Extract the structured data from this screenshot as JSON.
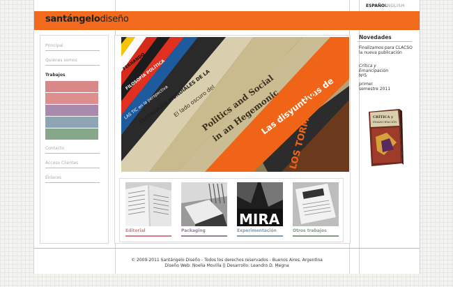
{
  "brand": {
    "name_bold": "santángelo",
    "name_light": "diseño",
    "accent": "#f26a1b"
  },
  "lang": {
    "es": "ESPAÑOL",
    "en": "ENGLISH"
  },
  "nav": {
    "items": [
      {
        "label": "Principal"
      },
      {
        "label": "Quiénes somos"
      },
      {
        "label": "Trabajos"
      },
      {
        "label": "Contacto"
      },
      {
        "label": "Acceso Clientes"
      },
      {
        "label": "Enlaces"
      }
    ],
    "swatches": [
      "#d98787",
      "#dc8f8e",
      "#a98aac",
      "#8ea4b4",
      "#87a888"
    ]
  },
  "thumbs": [
    {
      "label": "Editorial",
      "color": "#d77d7d"
    },
    {
      "label": "Packaging",
      "color": "#9a7aa0"
    },
    {
      "label": "Experimentación",
      "color": "#7d9bb0"
    },
    {
      "label": "Otros trabajos",
      "color": "#7a9e7c"
    }
  ],
  "news": {
    "title": "Novedades",
    "line1": "Finalizamos para CLACSO la nueva publicación",
    "italic1": "Crítica y",
    "italic2": "Emancipación",
    "line3": "Nº5",
    "line4": "primer semestre 2011"
  },
  "footer": {
    "line1": "© 2009-2011 Santángelo Diseño - Todos los derechos reservados - Buenos Aires, Argentina",
    "line2": "Diseño Web: Noelia Movilla || Desarrollo: Leandro D. Megna"
  },
  "hero_spines": [
    "Las disyuntivas de",
    "Politics and Social Movements in an Hegemonic",
    "El lado oscuro del",
    "ESCENARIOS MUNDIALES DE LA",
    "FILOSOFÍA POLÍTICA",
    "FERNANDO",
    "LAS TIC en la perspectiva de",
    "LOS TORMENTOS",
    "MIRA"
  ]
}
